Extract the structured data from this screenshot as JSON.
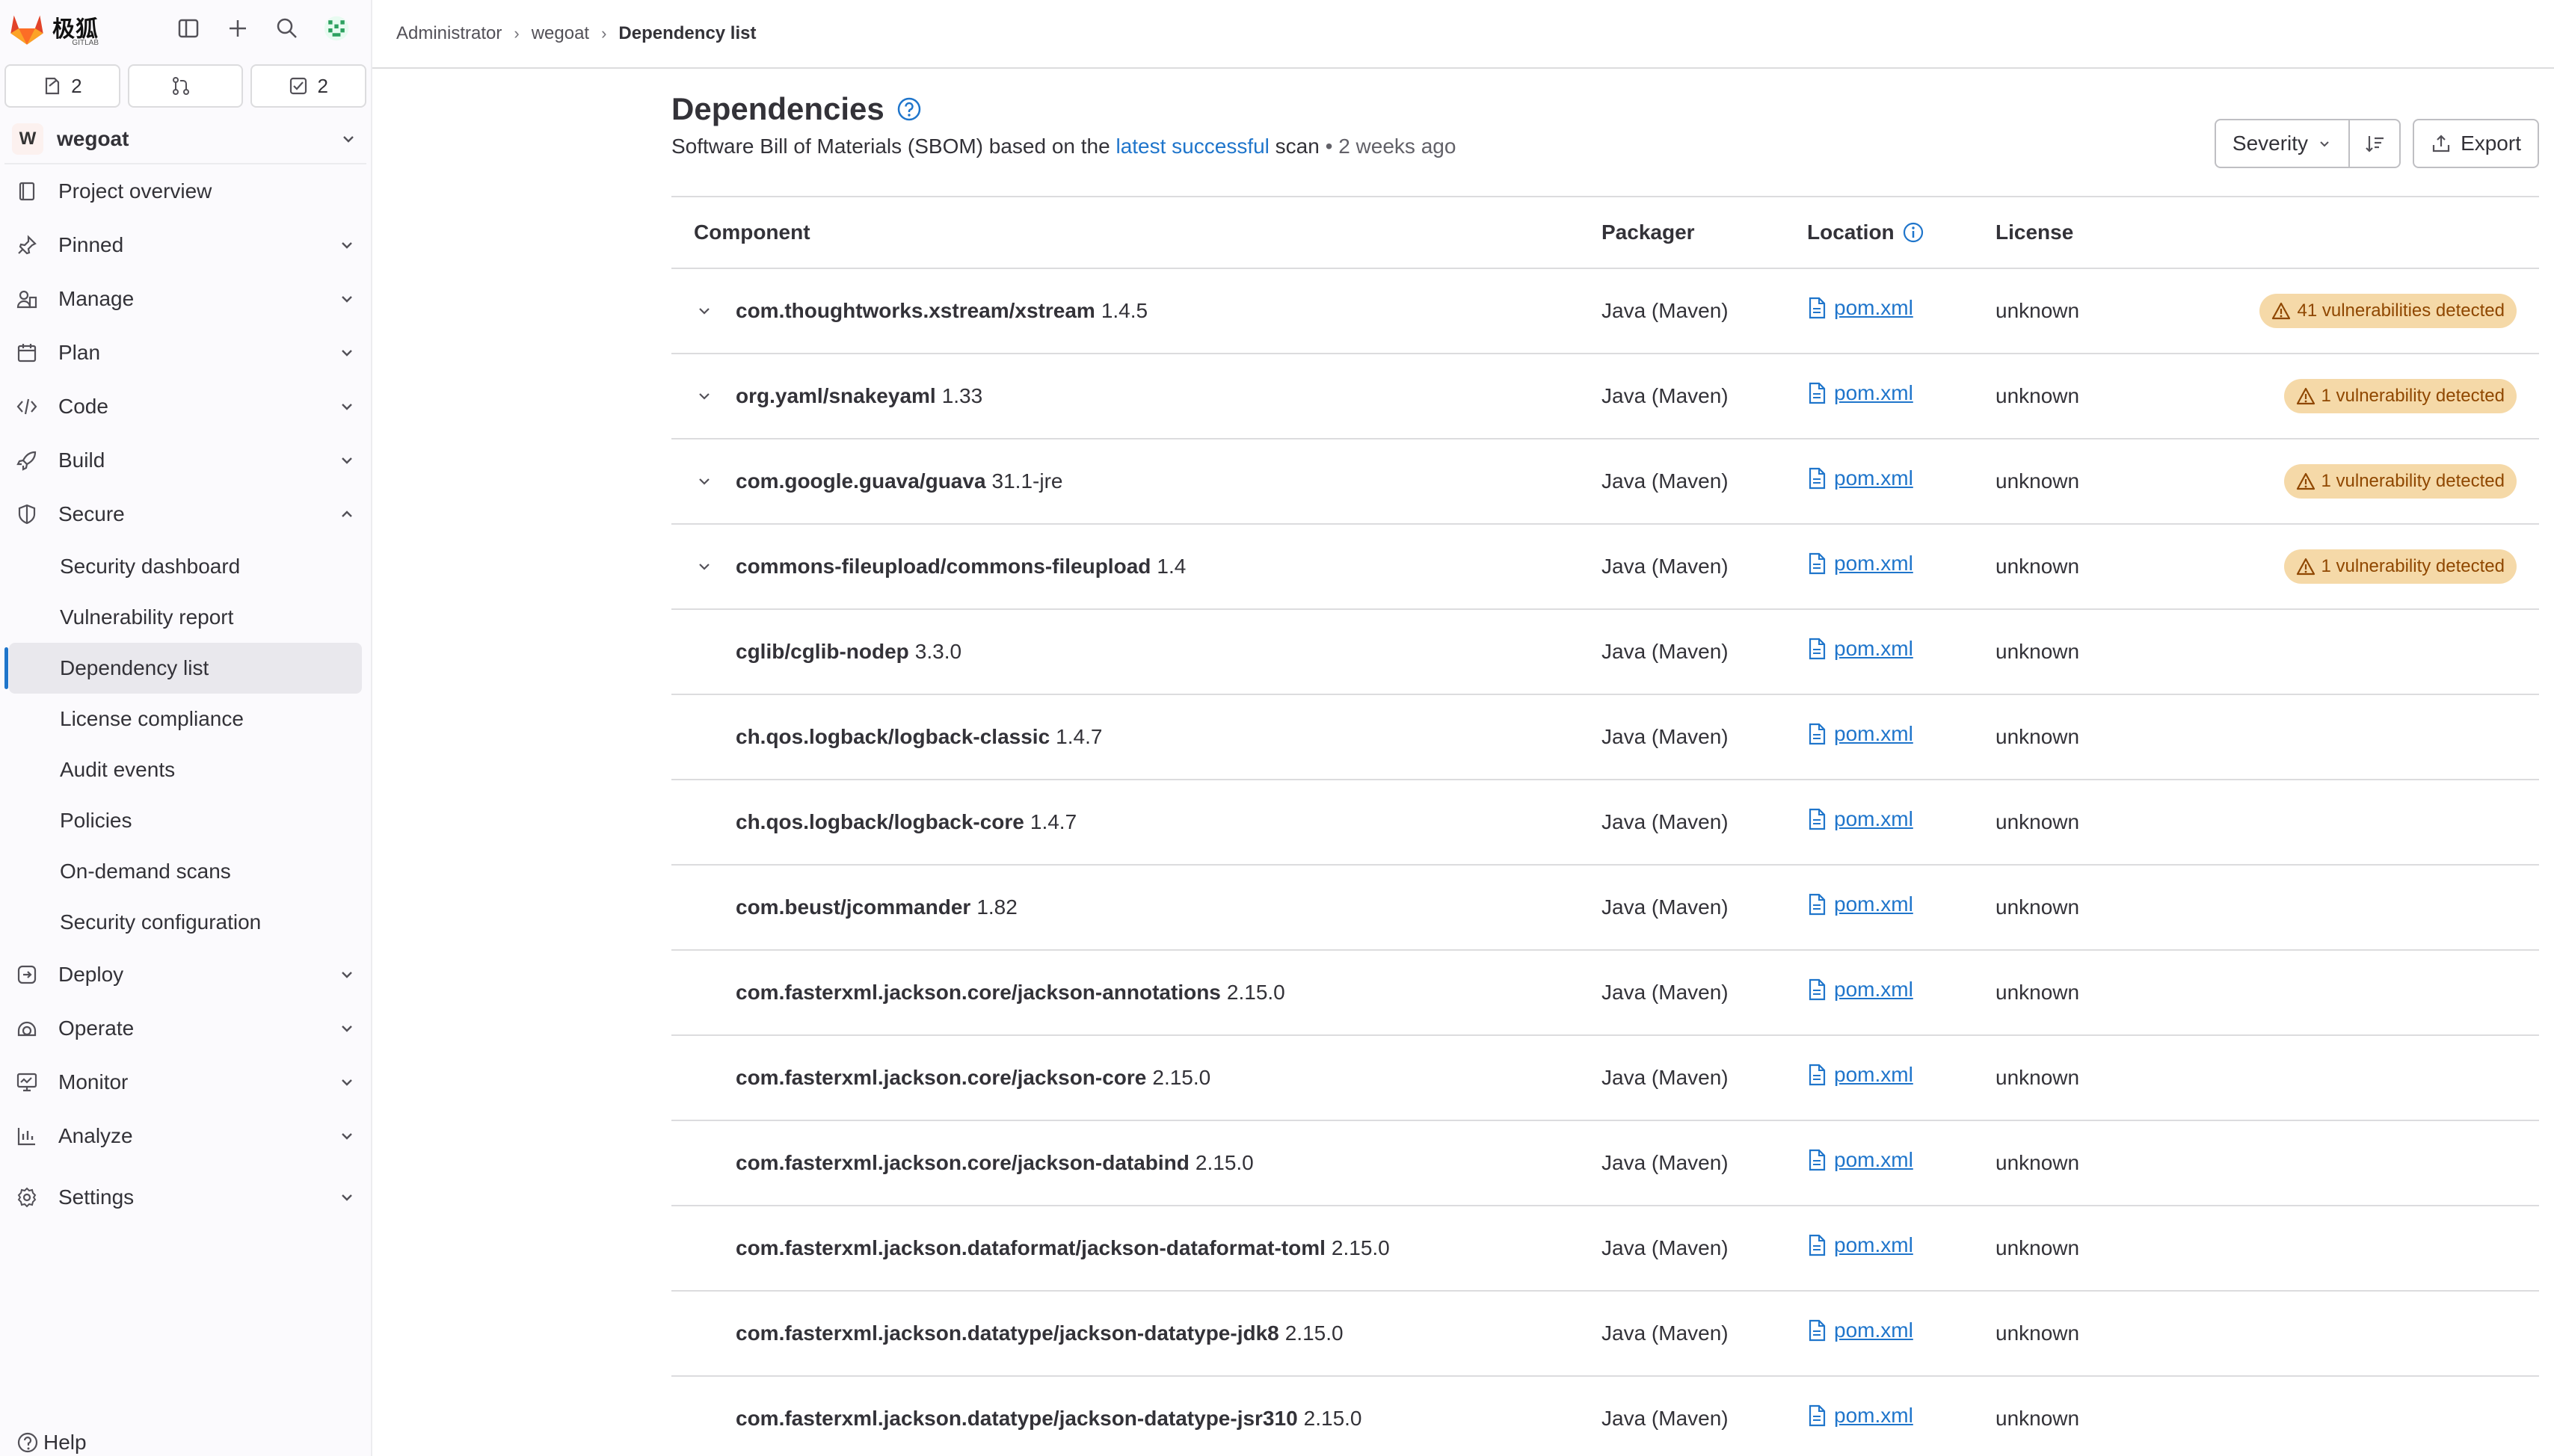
{
  "brand": {
    "name": "极狐",
    "sub": "GITLAB"
  },
  "sidebar": {
    "counters": [
      {
        "icon": "issues-icon",
        "count": "2"
      },
      {
        "icon": "merge-request-icon",
        "count": ""
      },
      {
        "icon": "todo-icon",
        "count": "2"
      }
    ],
    "project": {
      "avatar_letter": "W",
      "name": "wegoat"
    },
    "items": [
      {
        "label": "Project overview",
        "icon": "project-icon",
        "chevron": ""
      },
      {
        "label": "Pinned",
        "icon": "pin-icon",
        "chevron": "down"
      },
      {
        "label": "Manage",
        "icon": "users-icon",
        "chevron": "down"
      },
      {
        "label": "Plan",
        "icon": "calendar-icon",
        "chevron": "down"
      },
      {
        "label": "Code",
        "icon": "code-icon",
        "chevron": "down"
      },
      {
        "label": "Build",
        "icon": "rocket-icon",
        "chevron": "down"
      },
      {
        "label": "Secure",
        "icon": "shield-icon",
        "chevron": "up"
      }
    ],
    "secure_items": [
      {
        "label": "Security dashboard"
      },
      {
        "label": "Vulnerability report"
      },
      {
        "label": "Dependency list",
        "active": true
      },
      {
        "label": "License compliance"
      },
      {
        "label": "Audit events"
      },
      {
        "label": "Policies"
      },
      {
        "label": "On-demand scans"
      },
      {
        "label": "Security configuration"
      }
    ],
    "bottom_items": [
      {
        "label": "Deploy",
        "icon": "deploy-icon",
        "chevron": "down"
      },
      {
        "label": "Operate",
        "icon": "operate-icon",
        "chevron": "down"
      },
      {
        "label": "Monitor",
        "icon": "monitor-icon",
        "chevron": "down"
      },
      {
        "label": "Analyze",
        "icon": "chart-icon",
        "chevron": "down"
      },
      {
        "label": "Settings",
        "icon": "gear-icon",
        "chevron": "down"
      }
    ],
    "help": "Help"
  },
  "breadcrumb": [
    "Administrator",
    "wegoat",
    "Dependency list"
  ],
  "page": {
    "title": "Dependencies",
    "subtitle_pre": "Software Bill of Materials (SBOM) based on the ",
    "subtitle_link": "latest successful",
    "subtitle_post": " scan",
    "subtitle_sep": " • ",
    "subtitle_time": "2 weeks ago"
  },
  "controls": {
    "sort_label": "Severity",
    "export_label": "Export"
  },
  "table": {
    "headers": {
      "component": "Component",
      "packager": "Packager",
      "location": "Location",
      "license": "License"
    },
    "rows": [
      {
        "name": "com.thoughtworks.xstream/xstream",
        "version": "1.4.5",
        "packager": "Java (Maven)",
        "location": "pom.xml",
        "license": "unknown",
        "vuln": "41 vulnerabilities detected",
        "expandable": true
      },
      {
        "name": "org.yaml/snakeyaml",
        "version": "1.33",
        "packager": "Java (Maven)",
        "location": "pom.xml",
        "license": "unknown",
        "vuln": "1 vulnerability detected",
        "expandable": true
      },
      {
        "name": "com.google.guava/guava",
        "version": "31.1-jre",
        "packager": "Java (Maven)",
        "location": "pom.xml",
        "license": "unknown",
        "vuln": "1 vulnerability detected",
        "expandable": true
      },
      {
        "name": "commons-fileupload/commons-fileupload",
        "version": "1.4",
        "packager": "Java (Maven)",
        "location": "pom.xml",
        "license": "unknown",
        "vuln": "1 vulnerability detected",
        "expandable": true
      },
      {
        "name": "cglib/cglib-nodep",
        "version": "3.3.0",
        "packager": "Java (Maven)",
        "location": "pom.xml",
        "license": "unknown",
        "vuln": "",
        "expandable": false
      },
      {
        "name": "ch.qos.logback/logback-classic",
        "version": "1.4.7",
        "packager": "Java (Maven)",
        "location": "pom.xml",
        "license": "unknown",
        "vuln": "",
        "expandable": false
      },
      {
        "name": "ch.qos.logback/logback-core",
        "version": "1.4.7",
        "packager": "Java (Maven)",
        "location": "pom.xml",
        "license": "unknown",
        "vuln": "",
        "expandable": false
      },
      {
        "name": "com.beust/jcommander",
        "version": "1.82",
        "packager": "Java (Maven)",
        "location": "pom.xml",
        "license": "unknown",
        "vuln": "",
        "expandable": false
      },
      {
        "name": "com.fasterxml.jackson.core/jackson-annotations",
        "version": "2.15.0",
        "packager": "Java (Maven)",
        "location": "pom.xml",
        "license": "unknown",
        "vuln": "",
        "expandable": false
      },
      {
        "name": "com.fasterxml.jackson.core/jackson-core",
        "version": "2.15.0",
        "packager": "Java (Maven)",
        "location": "pom.xml",
        "license": "unknown",
        "vuln": "",
        "expandable": false
      },
      {
        "name": "com.fasterxml.jackson.core/jackson-databind",
        "version": "2.15.0",
        "packager": "Java (Maven)",
        "location": "pom.xml",
        "license": "unknown",
        "vuln": "",
        "expandable": false
      },
      {
        "name": "com.fasterxml.jackson.dataformat/jackson-dataformat-toml",
        "version": "2.15.0",
        "packager": "Java (Maven)",
        "location": "pom.xml",
        "license": "unknown",
        "vuln": "",
        "expandable": false
      },
      {
        "name": "com.fasterxml.jackson.datatype/jackson-datatype-jdk8",
        "version": "2.15.0",
        "packager": "Java (Maven)",
        "location": "pom.xml",
        "license": "unknown",
        "vuln": "",
        "expandable": false
      },
      {
        "name": "com.fasterxml.jackson.datatype/jackson-datatype-jsr310",
        "version": "2.15.0",
        "packager": "Java (Maven)",
        "location": "pom.xml",
        "license": "unknown",
        "vuln": "",
        "expandable": false
      }
    ]
  },
  "colors": {
    "link": "#1f75cb",
    "badge_bg": "#f5d9a8",
    "badge_fg": "#8f4700",
    "active_bar": "#1f75cb"
  }
}
